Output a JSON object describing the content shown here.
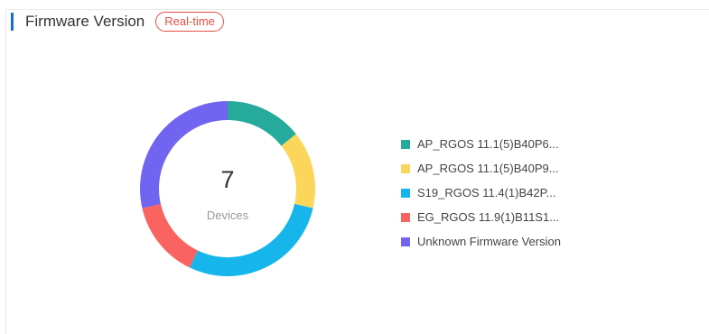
{
  "header": {
    "title": "Firmware Version",
    "badge": "Real-time"
  },
  "center": {
    "value": "7",
    "label": "Devices"
  },
  "chart_data": {
    "type": "pie",
    "variant": "donut",
    "total": 7,
    "series": [
      {
        "name": "AP_RGOS 11.1(5)B40P6...",
        "value": 1,
        "color": "#26aa9c"
      },
      {
        "name": "AP_RGOS 11.1(5)B40P9...",
        "value": 1,
        "color": "#fcd65b"
      },
      {
        "name": "S19_RGOS 11.4(1)B42P...",
        "value": 2,
        "color": "#16b6ec"
      },
      {
        "name": "EG_RGOS 11.9(1)B11S1...",
        "value": 1,
        "color": "#f96360"
      },
      {
        "name": "Unknown Firmware Version",
        "value": 2,
        "color": "#7064f0"
      }
    ],
    "legend_position": "right"
  }
}
